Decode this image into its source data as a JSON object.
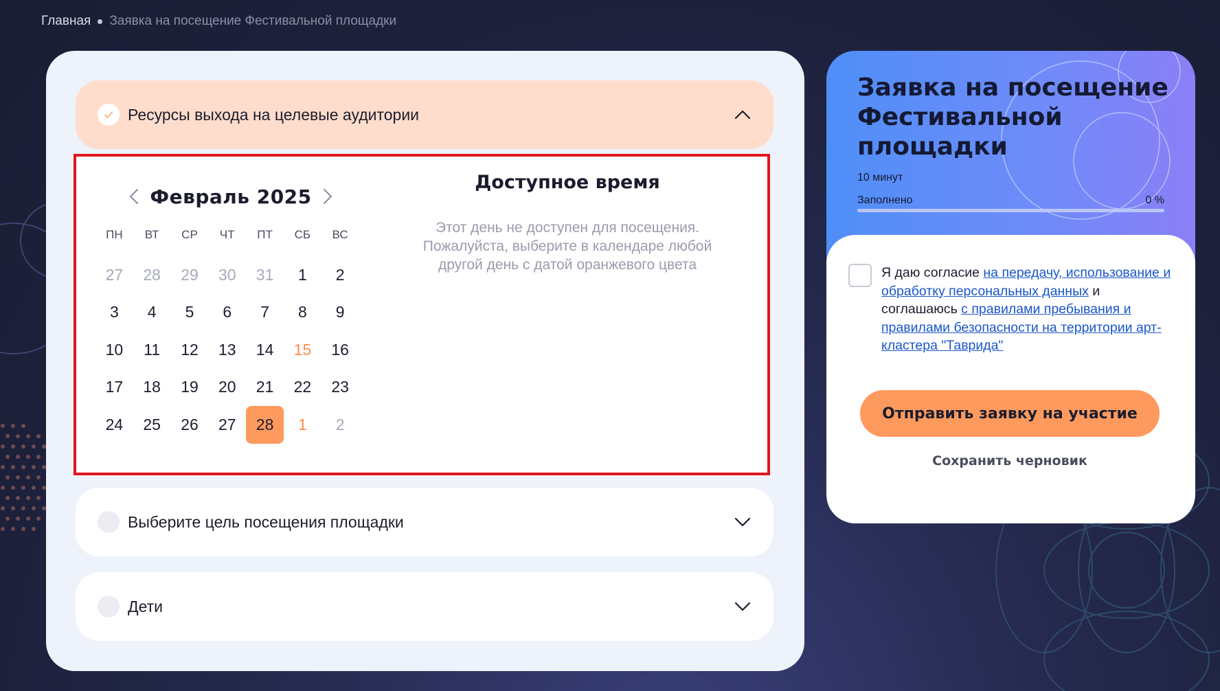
{
  "breadcrumb": {
    "home": "Главная",
    "current": "Заявка на посещение Фестивальной площадки"
  },
  "accordion": {
    "resources": {
      "label": "Ресурсы выхода на целевые аудитории",
      "completed": true,
      "expanded": true
    },
    "purpose": {
      "label": "Выберите цель посещения площадки",
      "completed": false,
      "expanded": false
    },
    "children": {
      "label": "Дети",
      "completed": false,
      "expanded": false
    }
  },
  "calendar": {
    "month": "Февраль 2025",
    "weekdays": [
      "ПН",
      "ВТ",
      "СР",
      "ЧТ",
      "ПТ",
      "СБ",
      "ВС"
    ],
    "weeks": [
      [
        {
          "d": "27",
          "s": "muted"
        },
        {
          "d": "28",
          "s": "muted"
        },
        {
          "d": "29",
          "s": "muted"
        },
        {
          "d": "30",
          "s": "muted"
        },
        {
          "d": "31",
          "s": "muted"
        },
        {
          "d": "1",
          "s": ""
        },
        {
          "d": "2",
          "s": ""
        }
      ],
      [
        {
          "d": "3",
          "s": ""
        },
        {
          "d": "4",
          "s": ""
        },
        {
          "d": "5",
          "s": ""
        },
        {
          "d": "6",
          "s": ""
        },
        {
          "d": "7",
          "s": ""
        },
        {
          "d": "8",
          "s": ""
        },
        {
          "d": "9",
          "s": ""
        }
      ],
      [
        {
          "d": "10",
          "s": ""
        },
        {
          "d": "11",
          "s": ""
        },
        {
          "d": "12",
          "s": ""
        },
        {
          "d": "13",
          "s": ""
        },
        {
          "d": "14",
          "s": ""
        },
        {
          "d": "15",
          "s": "avail"
        },
        {
          "d": "16",
          "s": ""
        }
      ],
      [
        {
          "d": "17",
          "s": ""
        },
        {
          "d": "18",
          "s": ""
        },
        {
          "d": "19",
          "s": ""
        },
        {
          "d": "20",
          "s": ""
        },
        {
          "d": "21",
          "s": ""
        },
        {
          "d": "22",
          "s": ""
        },
        {
          "d": "23",
          "s": ""
        }
      ],
      [
        {
          "d": "24",
          "s": ""
        },
        {
          "d": "25",
          "s": ""
        },
        {
          "d": "26",
          "s": ""
        },
        {
          "d": "27",
          "s": ""
        },
        {
          "d": "28",
          "s": "sel"
        },
        {
          "d": "1",
          "s": "avail"
        },
        {
          "d": "2",
          "s": "muted"
        }
      ]
    ]
  },
  "time": {
    "title": "Доступное время",
    "message": "Этот день не доступен для посещения. Пожалуйста, выберите в календаре любой другой день с датой оранжевого цвета"
  },
  "side": {
    "title": "Заявка на посещение Фестивальной площадки",
    "duration": "10 минут",
    "progress_label": "Заполнено",
    "progress_value": "0 %",
    "progress_fraction": 0,
    "consent_prefix": "Я даю согласие ",
    "consent_link1": "на передачу, использование и обработку персональных данных",
    "consent_middle": " и соглашаюсь ",
    "consent_link2": "с правилами пребывания и правилами безопасности на территории арт-кластера \"Таврида\"",
    "submit": "Отправить заявку на участие",
    "draft": "Сохранить черновик"
  },
  "colors": {
    "accent": "#ff9a5e",
    "available_date": "#ff8c4b",
    "link": "#1a56c9",
    "highlight_border": "#e0161c"
  }
}
